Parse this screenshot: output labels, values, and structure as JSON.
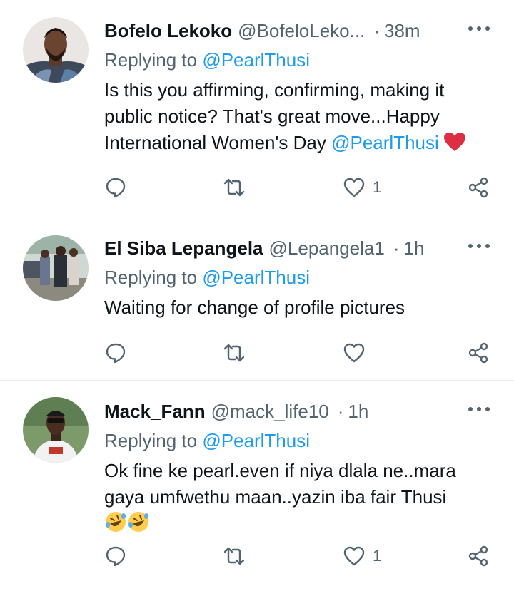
{
  "tweets": [
    {
      "name": "Bofelo Lekoko",
      "handle": "@BofeloLeko...",
      "dot": "·",
      "time": "38m",
      "replying_prefix": "Replying to ",
      "replying_to": "@PearlThusi",
      "text_lines": [
        "Is this you affirming, confirming, making it",
        "public notice? That's great move...Happy",
        "International Women's Day "
      ],
      "text_mention": "@PearlThusi",
      "trailing_emoji": "red-heart",
      "like_count": "1"
    },
    {
      "name": "El Siba Lepangela",
      "handle": "@Lepangela1",
      "dot": "·",
      "time": "1h",
      "replying_prefix": "Replying to ",
      "replying_to": "@PearlThusi",
      "text_lines": [
        "Waiting for change of profile pictures"
      ],
      "like_count": ""
    },
    {
      "name": "Mack_Fann",
      "handle": "@mack_life10",
      "dot": "·",
      "time": "1h",
      "replying_prefix": "Replying to ",
      "replying_to": "@PearlThusi",
      "text_lines": [
        "Ok fine ke pearl.even if niya dlala ne..mara",
        "gaya umfwethu maan..yazin iba fair Thusi"
      ],
      "emojis": [
        "rolling-on-floor-laughing",
        "rolling-on-floor-laughing"
      ],
      "like_count": "1"
    }
  ],
  "colors": {
    "text": "#0f1419",
    "secondary": "#536471",
    "link": "#1d9bf0",
    "divider": "#e6ecf0",
    "heart": "#e0245e"
  },
  "icons": [
    "reply-icon",
    "retweet-icon",
    "like-icon",
    "share-icon",
    "more-icon"
  ]
}
